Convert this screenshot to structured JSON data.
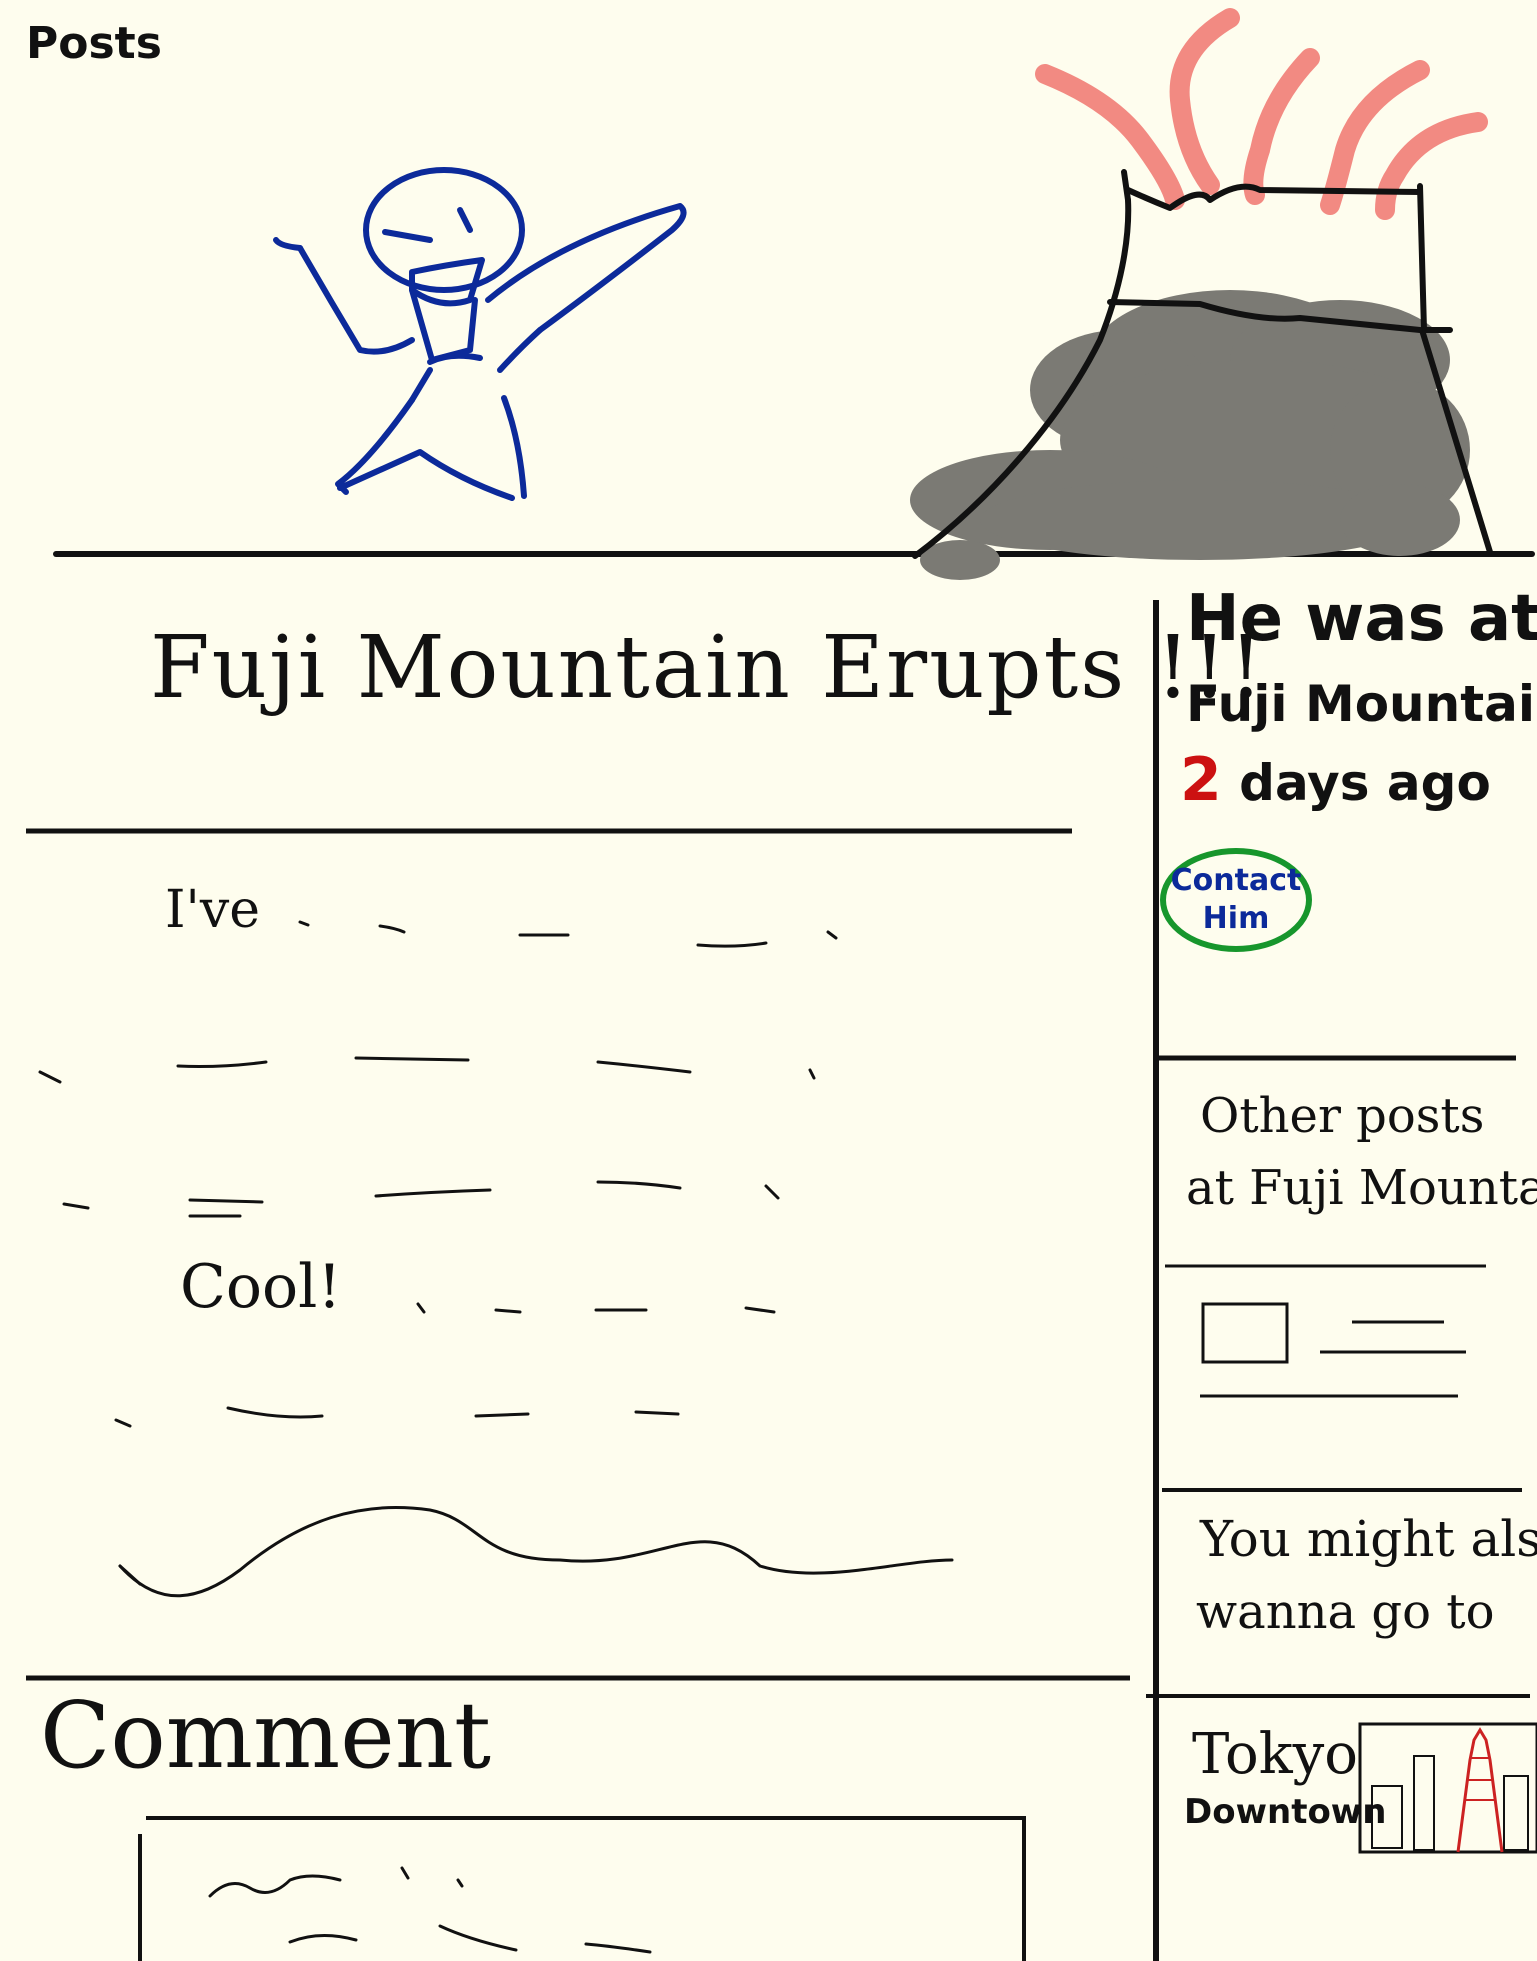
{
  "header": {
    "title": "Posts"
  },
  "post": {
    "title": "Fuji Mountain Erupts !!!",
    "body_intro": "I've",
    "body_exclaim": "Cool!"
  },
  "author_info": {
    "line1": "He was at",
    "line2": "Fuji Mountain",
    "days_number": "2",
    "days_suffix": "days ago",
    "contact_line1": "Contact",
    "contact_line2": "Him"
  },
  "other_posts": {
    "heading_line1": "Other posts",
    "heading_line2": "at Fuji Mountain"
  },
  "suggestions": {
    "heading_line1": "You might also",
    "heading_line2": "wanna go to",
    "destination_line1": "Tokyo",
    "destination_line2": "Downtown"
  },
  "comments": {
    "heading": "Comment"
  },
  "colors": {
    "background": "#fefdee",
    "stick_figure": "#0c2a9a",
    "lava": "#f28a82",
    "smoke": "#7b7a74",
    "days_highlight": "#cc1111",
    "contact_border": "#17962c",
    "tower": "#cc2222"
  },
  "icons": {
    "hero_illustration": "stick-figure-cheering-icon",
    "volcano": "erupting-volcano-icon",
    "post_thumbnail": "image-placeholder-icon",
    "destination_thumbnail": "city-skyline-tower-icon"
  }
}
